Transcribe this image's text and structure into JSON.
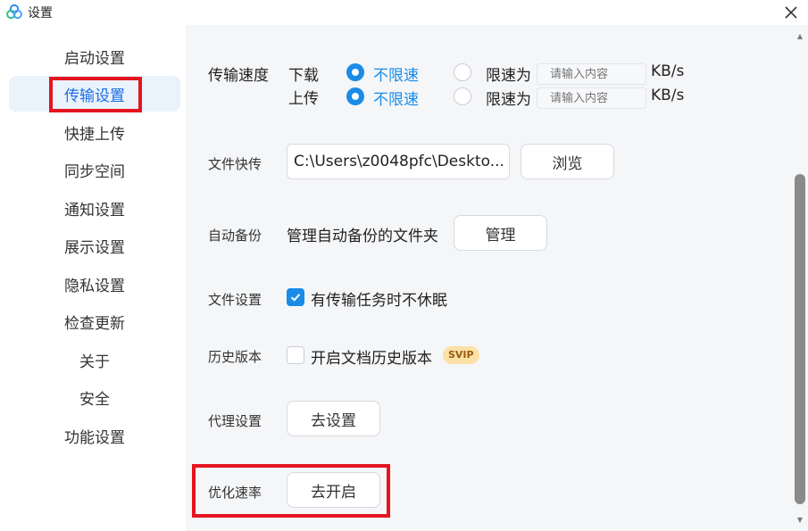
{
  "window": {
    "title": "设置"
  },
  "sidebar": {
    "items": [
      {
        "label": "启动设置"
      },
      {
        "label": "传输设置"
      },
      {
        "label": "快捷上传"
      },
      {
        "label": "同步空间"
      },
      {
        "label": "通知设置"
      },
      {
        "label": "展示设置"
      },
      {
        "label": "隐私设置"
      },
      {
        "label": "检查更新"
      },
      {
        "label": "关于"
      },
      {
        "label": "安全"
      },
      {
        "label": "功能设置"
      }
    ],
    "active": "传输设置"
  },
  "transfer_speed": {
    "label": "传输速度",
    "download": {
      "label": "下载",
      "unlimited_label": "不限速",
      "limit_label": "限速为",
      "placeholder": "请输入内容",
      "unit": "KB/s",
      "selected": "不限速"
    },
    "upload": {
      "label": "上传",
      "unlimited_label": "不限速",
      "limit_label": "限速为",
      "placeholder": "请输入内容",
      "unit": "KB/s",
      "selected": "不限速"
    }
  },
  "quick_file": {
    "label": "文件快传",
    "path": "C:\\Users\\z0048pfc\\Deskto...",
    "browse_label": "浏览"
  },
  "auto_backup": {
    "label": "自动备份",
    "description": "管理自动备份的文件夹",
    "manage_label": "管理"
  },
  "file_settings": {
    "label": "文件设置",
    "no_sleep_label": "有传输任务时不休眠",
    "no_sleep_checked": true
  },
  "history": {
    "label": "历史版本",
    "enable_label": "开启文档历史版本",
    "enable_checked": false,
    "badge": "SVIP"
  },
  "proxy": {
    "label": "代理设置",
    "button_label": "去设置"
  },
  "optimize": {
    "label": "优化速率",
    "button_label": "去开启"
  },
  "colors": {
    "accent": "#1a8ce8",
    "active_bg": "#eaf3fc",
    "highlight": "#e5141f",
    "svip_bg": "#fbe1a6"
  }
}
